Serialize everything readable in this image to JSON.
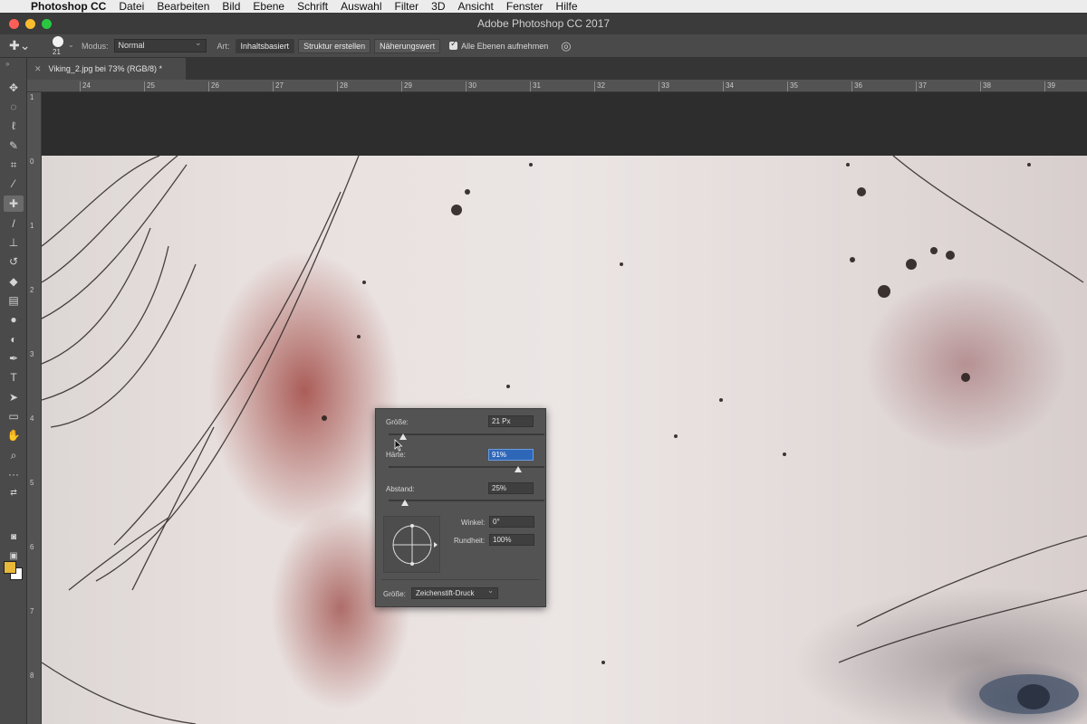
{
  "menubar": {
    "app_name": "Photoshop CC",
    "items": [
      "Datei",
      "Bearbeiten",
      "Bild",
      "Ebene",
      "Schrift",
      "Auswahl",
      "Filter",
      "3D",
      "Ansicht",
      "Fenster",
      "Hilfe"
    ]
  },
  "window": {
    "title": "Adobe Photoshop CC 2017",
    "traffic_colors": [
      "#fc5f57",
      "#fdbc2e",
      "#28c840"
    ]
  },
  "options_bar": {
    "brush_size": "21",
    "mode_label": "Modus:",
    "mode_value": "Normal",
    "type_label": "Art:",
    "type_buttons": [
      "Inhaltsbasiert",
      "Struktur erstellen",
      "Näherungswert"
    ],
    "sample_all_label": "Alle Ebenen aufnehmen",
    "sample_all_checked": true
  },
  "document_tab": {
    "title": "Viking_2.jpg bei 73% (RGB/8) *"
  },
  "rulers": {
    "horizontal": [
      "24",
      "25",
      "26",
      "27",
      "28",
      "29",
      "30",
      "31",
      "32",
      "33",
      "34",
      "35",
      "36",
      "37",
      "38",
      "39"
    ],
    "vertical": [
      "1",
      "0",
      "1",
      "2",
      "3",
      "4",
      "5",
      "6",
      "7",
      "8"
    ]
  },
  "tools": [
    "move-tool",
    "marquee-tool",
    "lasso-tool",
    "quick-selection-tool",
    "crop-tool",
    "eyedropper-tool",
    "spot-healing-brush-tool",
    "brush-tool",
    "clone-stamp-tool",
    "history-brush-tool",
    "eraser-tool",
    "gradient-tool",
    "blur-tool",
    "dodge-tool",
    "pen-tool",
    "type-tool",
    "path-selection-tool",
    "rectangle-tool",
    "hand-tool",
    "zoom-tool",
    "more-tools"
  ],
  "colors": {
    "foreground": "#e8b83a",
    "background": "#ffffff",
    "selection_highlight": "#2f67b8"
  },
  "brush_popup": {
    "size_label": "Größe:",
    "size_value": "21 Px",
    "size_fraction": 0.03,
    "hardness_label": "Härte:",
    "hardness_value": "91%",
    "hardness_fraction": 0.91,
    "spacing_label": "Abstand:",
    "spacing_value": "25%",
    "spacing_fraction": 0.03,
    "angle_label": "Winkel:",
    "angle_value": "0°",
    "roundness_label": "Rundheit:",
    "roundness_value": "100%",
    "pen_size_label": "Größe:",
    "pen_size_value": "Zeichenstift-Druck"
  }
}
